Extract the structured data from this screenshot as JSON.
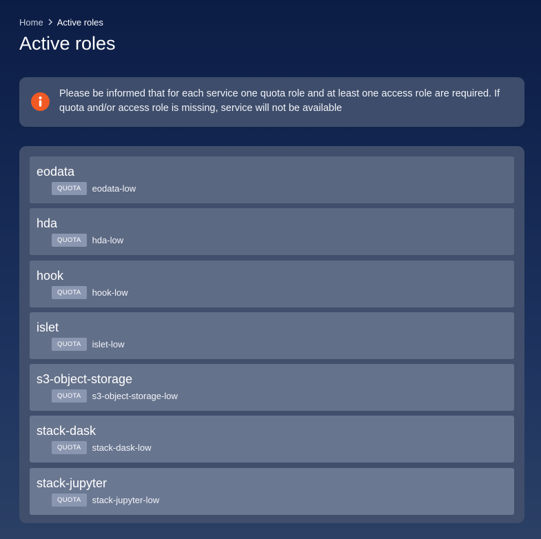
{
  "breadcrumb": {
    "home": "Home",
    "current": "Active roles"
  },
  "page_title": "Active roles",
  "info": {
    "icon": "info-icon",
    "icon_color": "#f15a24",
    "text": "Please be informed that for each service one quota role and at least one access role are required. If quota and/or access role is missing, service will not be available"
  },
  "roles": [
    {
      "name": "eodata",
      "badge": "QUOTA",
      "value": "eodata-low",
      "bg": "#5a6781"
    },
    {
      "name": "hda",
      "badge": "QUOTA",
      "value": "hda-low",
      "bg": "#5c6983"
    },
    {
      "name": "hook",
      "badge": "QUOTA",
      "value": "hook-low",
      "bg": "#5f6c86"
    },
    {
      "name": "islet",
      "badge": "QUOTA",
      "value": "islet-low",
      "bg": "#626f89"
    },
    {
      "name": "s3-object-storage",
      "badge": "QUOTA",
      "value": "s3-object-storage-low",
      "bg": "#65728b"
    },
    {
      "name": "stack-dask",
      "badge": "QUOTA",
      "value": "stack-dask-low",
      "bg": "#68758e"
    },
    {
      "name": "stack-jupyter",
      "badge": "QUOTA",
      "value": "stack-jupyter-low",
      "bg": "#6b7892"
    }
  ]
}
